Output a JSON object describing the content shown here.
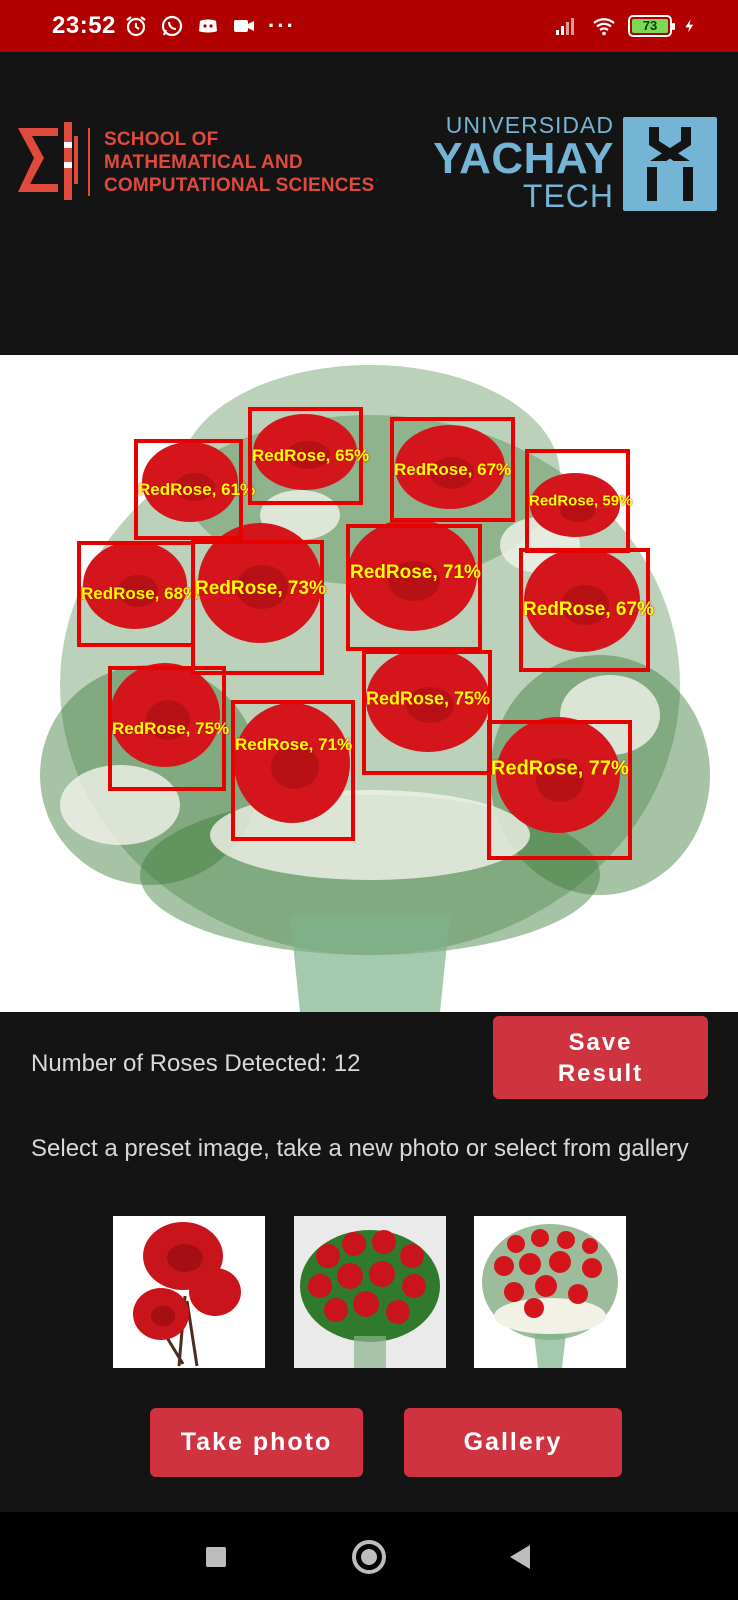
{
  "status_bar": {
    "time": "23:52",
    "dots": "···",
    "battery": "73",
    "icons": [
      "alarm-icon",
      "whatsapp-icon",
      "discord-icon",
      "video-icon",
      "signal-icon",
      "wifi-icon",
      "battery-icon",
      "charging-icon"
    ]
  },
  "header": {
    "school_line1": "SCHOOL OF",
    "school_line2": "MATHEMATICAL AND",
    "school_line3": "COMPUTATIONAL SCIENCES",
    "university_line1": "UNIVERSIDAD",
    "university_line2": "YACHAY",
    "university_line3": "TECH"
  },
  "detections": [
    {
      "label": "RedRose, 61%"
    },
    {
      "label": "RedRose, 65%"
    },
    {
      "label": "RedRose, 67%"
    },
    {
      "label": "RedRose, 59%"
    },
    {
      "label": "RedRose, 68%"
    },
    {
      "label": "RedRose, 73%"
    },
    {
      "label": "RedRose, 71%"
    },
    {
      "label": "RedRose, 67%"
    },
    {
      "label": "RedRose, 75%"
    },
    {
      "label": "RedRose, 75%"
    },
    {
      "label": "RedRose, 71%"
    },
    {
      "label": "RedRose, 77%"
    }
  ],
  "results": {
    "count_text": "Number of Roses Detected: 12",
    "save_button": "Save Result"
  },
  "instructions": "Select a preset image, take a new photo or select from gallery",
  "presets": [
    "three-roses-preset",
    "roses-bouquet-preset",
    "roses-vase-preset"
  ],
  "actions": {
    "take_photo": "Take photo",
    "gallery": "Gallery"
  },
  "colors": {
    "status_bar": "#b00000",
    "accent_button": "#cf3340",
    "box": "#e60000",
    "label": "#ffff00",
    "school_red": "#e04a3c",
    "yachay_blue": "#74b4d4"
  }
}
